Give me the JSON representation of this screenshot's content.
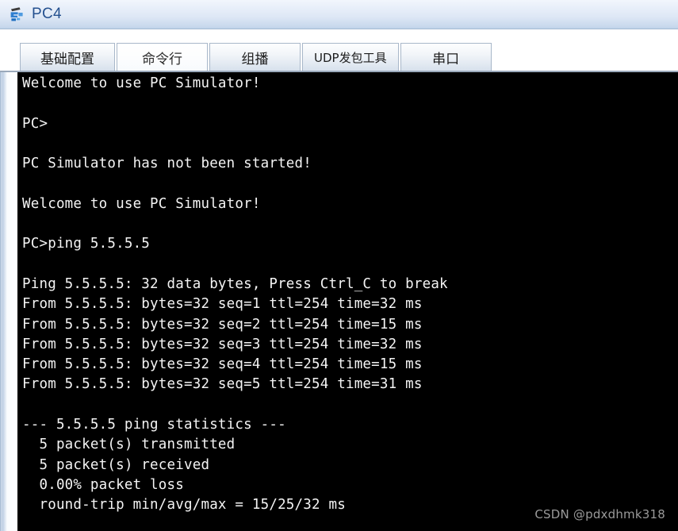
{
  "window": {
    "title": "PC4",
    "icon": "pc-device-icon"
  },
  "tabs": [
    {
      "label": "基础配置",
      "active": false,
      "name": "tab-basic-config"
    },
    {
      "label": "命令行",
      "active": true,
      "name": "tab-command-line"
    },
    {
      "label": "组播",
      "active": false,
      "name": "tab-multicast"
    },
    {
      "label": "UDP发包工具",
      "active": false,
      "name": "tab-udp-tool"
    },
    {
      "label": "串口",
      "active": false,
      "name": "tab-serial-port"
    }
  ],
  "terminal": {
    "lines": [
      "Welcome to use PC Simulator!",
      "",
      "PC>",
      "",
      "PC Simulator has not been started!",
      "",
      "Welcome to use PC Simulator!",
      "",
      "PC>ping 5.5.5.5",
      "",
      "Ping 5.5.5.5: 32 data bytes, Press Ctrl_C to break",
      "From 5.5.5.5: bytes=32 seq=1 ttl=254 time=32 ms",
      "From 5.5.5.5: bytes=32 seq=2 ttl=254 time=15 ms",
      "From 5.5.5.5: bytes=32 seq=3 ttl=254 time=32 ms",
      "From 5.5.5.5: bytes=32 seq=4 ttl=254 time=15 ms",
      "From 5.5.5.5: bytes=32 seq=5 ttl=254 time=31 ms",
      "",
      "--- 5.5.5.5 ping statistics ---",
      "  5 packet(s) transmitted",
      "  5 packet(s) received",
      "  0.00% packet loss",
      "  round-trip min/avg/max = 15/25/32 ms"
    ],
    "ping_target": "5.5.5.5",
    "data_bytes": "32",
    "transmitted": "5",
    "received": "5",
    "packet_loss": "0.00%",
    "rtt_min": "15",
    "rtt_avg": "25",
    "rtt_max": "32",
    "background_color": "#000000",
    "text_color": "#f4f4f4"
  },
  "watermark": {
    "text": "CSDN @pdxdhmk318"
  },
  "colors": {
    "titlebar_text": "#24508f",
    "titlebar_gradient_top": "#f2f6fc",
    "titlebar_gradient_bottom": "#b9cde6",
    "tab_border": "#a8b7c9"
  }
}
